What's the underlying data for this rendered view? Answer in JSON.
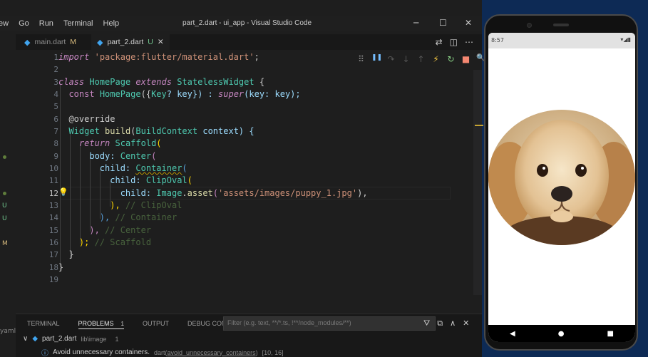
{
  "window": {
    "menu": [
      "ew",
      "Go",
      "Run",
      "Terminal",
      "Help"
    ],
    "title": "part_2.dart - ui_app - Visual Studio Code",
    "controls": {
      "minimize": "─",
      "maximize": "☐",
      "close": "✕"
    }
  },
  "tabs": [
    {
      "label": "main.dart",
      "status": "M",
      "active": false
    },
    {
      "label": "part_2.dart",
      "status": "U",
      "active": true,
      "close": "✕"
    }
  ],
  "gutter_marks": [
    "U",
    "U",
    "M"
  ],
  "editor": {
    "line_numbers": [
      "1",
      "2",
      "3",
      "4",
      "5",
      "6",
      "7",
      "8",
      "9",
      "10",
      "11",
      "12",
      "13",
      "14",
      "15",
      "16",
      "17",
      "18",
      "19"
    ],
    "current_line": "12",
    "lines": {
      "l1_kw": "import",
      "l1_str": "'package:flutter/material.dart'",
      "l1_end": ";",
      "l3_kw": "class",
      "l3_name": "HomePage",
      "l3_ext": "extends",
      "l3_base": "StatelessWidget",
      "l3_brace": "{",
      "l4_kw": "const",
      "l4_name": "HomePage",
      "l4_open": "({",
      "l4_type": "Key",
      "l4_rest": "? key}) :",
      "l4_super": "super",
      "l4_args": "(key: key);",
      "l6_ann": "@override",
      "l7_type": "Widget",
      "l7_fn": "build",
      "l7_open": "(",
      "l7_ptype": "BuildContext",
      "l7_rest": "context) {",
      "l8_kw": "return",
      "l8_type": "Scaffold",
      "l8_open": "(",
      "l9_prop": "body:",
      "l9_type": "Center",
      "l9_open": "(",
      "l10_prop": "child:",
      "l10_type": "Container",
      "l10_open": "(",
      "l11_prop": "child:",
      "l11_type": "ClipOval",
      "l11_open": "(",
      "l12_prop": "child:",
      "l12_type": "Image",
      "l12_dot": ".",
      "l12_fn": "asset",
      "l12_open": "(",
      "l12_str": "'assets/images/puppy_1.jpg'",
      "l12_close": "),",
      "l13_close": "),",
      "l13_cm": "// ClipOval",
      "l14_close": "),",
      "l14_cm": "// Container",
      "l15_close": "),",
      "l15_cm": "// Center",
      "l16_close": ");",
      "l16_cm": "// Scaffold",
      "l17_close": "}",
      "l18_close": "}"
    }
  },
  "debug_toolbar": [
    "⠿",
    "❚❚",
    "↷",
    "↓",
    "↑",
    "⚡",
    "↻",
    "■",
    "🔍"
  ],
  "panel": {
    "tabs": [
      "TERMINAL",
      "PROBLEMS",
      "OUTPUT",
      "DEBUG CONSOLE"
    ],
    "problems_count": "1",
    "filter_placeholder": "Filter (e.g. text, **/*.ts, !**/node_modules/**)",
    "file": "part_2.dart",
    "file_path": "lib\\image",
    "file_count": "1",
    "message": "Avoid unnecessary containers.",
    "source": "dart(",
    "rule": "avoid_unnecessary_containers",
    "source_end": ")",
    "position": "[10, 16]"
  },
  "side": {
    "yaml": "yaml"
  },
  "phone": {
    "time": "8:57",
    "status_right": "▾◢▮",
    "nav": [
      "◀",
      "●",
      "■"
    ]
  },
  "colors": {
    "editor_bg": "#1e1e1e",
    "phone_bg": "#0d2a55",
    "accent_dart": "#40a4ee"
  }
}
